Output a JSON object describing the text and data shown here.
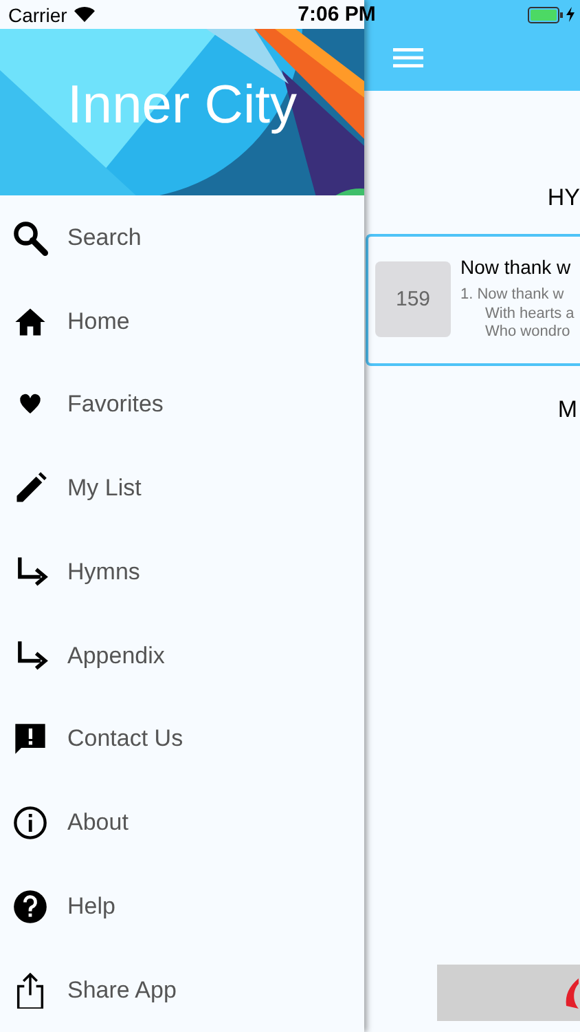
{
  "status_bar": {
    "carrier": "Carrier",
    "time": "7:06 PM"
  },
  "drawer": {
    "title": "Inner City",
    "items": [
      {
        "label": "Search",
        "kind": "search"
      },
      {
        "label": "Home",
        "kind": "home"
      },
      {
        "label": "Favorites",
        "kind": "heart"
      },
      {
        "label": "My List",
        "kind": "pencil"
      },
      {
        "label": "Hymns",
        "kind": "turn"
      },
      {
        "label": "Appendix",
        "kind": "turn"
      },
      {
        "label": "Contact Us",
        "kind": "feedback"
      },
      {
        "label": "About",
        "kind": "info"
      },
      {
        "label": "Help",
        "kind": "help"
      },
      {
        "label": "Share App",
        "kind": "share"
      }
    ]
  },
  "main": {
    "heading": "HY",
    "card": {
      "number": "159",
      "title": "Now thank w",
      "lines": [
        "1. Now thank w",
        "With hearts a",
        "Who wondro"
      ]
    },
    "subheading": "M"
  }
}
